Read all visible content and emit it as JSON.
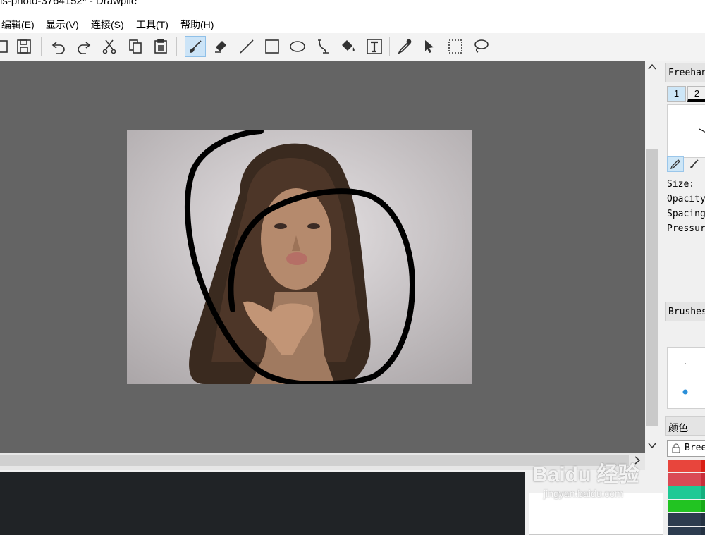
{
  "window": {
    "title": "ls-photo-3764152* - Drawpile"
  },
  "menu": [
    {
      "label": "编辑(E)"
    },
    {
      "label": "显示(V)"
    },
    {
      "label": "连接(S)"
    },
    {
      "label": "工具(T)"
    },
    {
      "label": "帮助(H)"
    }
  ],
  "toolbar": {
    "buttons": [
      {
        "icon": "new-file-icon"
      },
      {
        "icon": "save-icon"
      },
      {
        "icon": "undo-icon"
      },
      {
        "icon": "redo-icon"
      },
      {
        "icon": "cut-icon"
      },
      {
        "icon": "copy-icon"
      },
      {
        "icon": "paste-icon"
      },
      {
        "icon": "freehand-brush-icon",
        "active": true
      },
      {
        "icon": "eraser-icon"
      },
      {
        "icon": "line-icon"
      },
      {
        "icon": "rectangle-icon"
      },
      {
        "icon": "ellipse-icon"
      },
      {
        "icon": "bezier-icon"
      },
      {
        "icon": "flood-fill-icon"
      },
      {
        "icon": "text-icon"
      },
      {
        "icon": "color-picker-icon"
      },
      {
        "icon": "move-pointer-icon"
      },
      {
        "icon": "rect-select-icon"
      },
      {
        "icon": "lasso-icon"
      }
    ]
  },
  "dock": {
    "tool_settings_title": "Freehan",
    "slots": [
      "1",
      "2"
    ],
    "size_label": "Size:",
    "opacity_label": "Opacity",
    "spacing_label": "Spacing",
    "pressure_label": "Pressur",
    "brushes_title": "Brushes",
    "color_title": "颜色",
    "palette_name": "Bree",
    "swatches": [
      {
        "left": "#e8453c",
        "right": "#d91e14"
      },
      {
        "left": "#da4a55",
        "right": "#c82e3a"
      },
      {
        "left": "#1fc995",
        "right": "#14b07e"
      },
      {
        "left": "#22c422",
        "right": "#17aa17"
      },
      {
        "left": "#2d3c4f",
        "right": "#243242"
      },
      {
        "left": "#2d3c4f",
        "right": "#243242"
      }
    ]
  },
  "watermark": {
    "main": "Baidu 经验",
    "sub": "jingyan.baidu.com"
  },
  "colors": {
    "canvas_bg": "#646464",
    "chat_bg": "#202326",
    "stroke": "#000000"
  }
}
